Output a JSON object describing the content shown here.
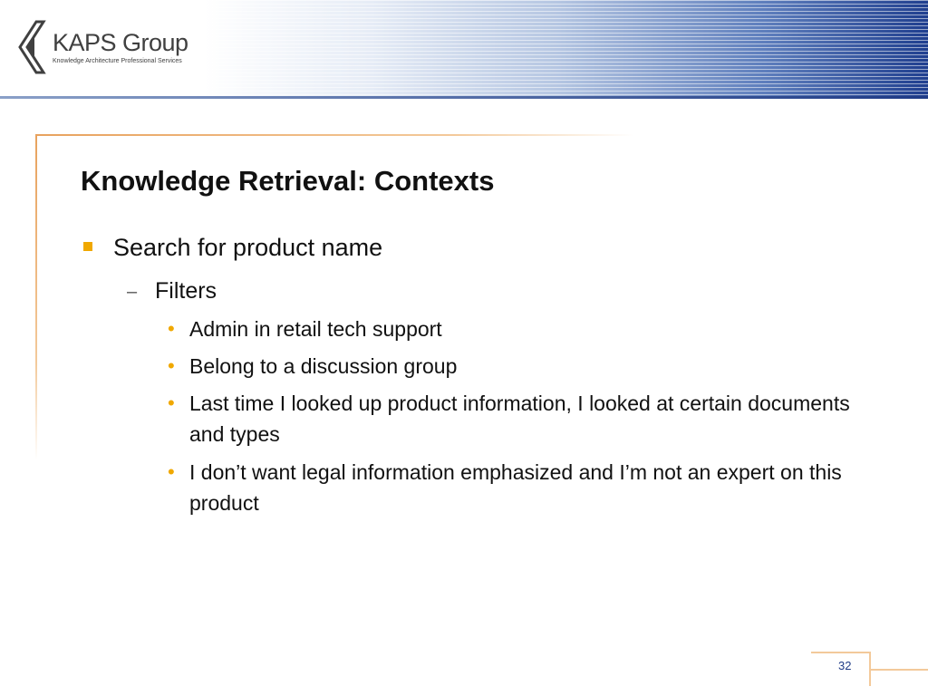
{
  "logo": {
    "name": "KAPS Group",
    "tagline": "Knowledge Architecture Professional Services"
  },
  "slide": {
    "title": "Knowledge Retrieval: Contexts",
    "bullet_level1": "Search for product name",
    "bullet_level2_marker": "–",
    "bullet_level2": "Filters",
    "bullet_level3": [
      "Admin in retail tech support",
      "Belong to a discussion group",
      "Last time I looked up product information, I looked at certain documents and types",
      "I don’t want legal information emphasized and I’m not an expert on this product"
    ],
    "page_number": "32"
  },
  "colors": {
    "accent_orange": "#f0a800",
    "frame_orange": "#e8a25e",
    "header_blue": "#203f8f"
  }
}
